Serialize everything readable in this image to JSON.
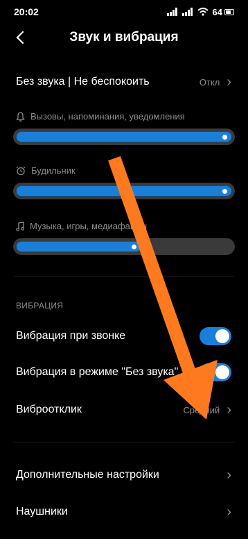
{
  "status": {
    "time": "20:02",
    "battery": "64"
  },
  "header": {
    "title": "Звук и вибрация"
  },
  "dnd": {
    "label": "Без звука | Не беспокоить",
    "value": "Откл"
  },
  "sliders": [
    {
      "label": "Вызовы, напоминания, уведомления",
      "icon": "bell-icon",
      "level_percent": 100
    },
    {
      "label": "Будильник",
      "icon": "alarm-clock-icon",
      "level_percent": 100
    },
    {
      "label": "Музыка, игры, медиафайлы",
      "icon": "music-note-icon",
      "level_percent": 58
    }
  ],
  "vibration": {
    "section_title": "ВИБРАЦИЯ",
    "ring_label": "Вибрация при звонке",
    "ring_on": true,
    "silent_label": "Вибрация в режиме \"Без звука\"",
    "silent_on": true,
    "feedback_label": "Виброотклик",
    "feedback_value": "Средний"
  },
  "more": {
    "advanced_label": "Дополнительные настройки",
    "headphones_label": "Наушники"
  },
  "colors": {
    "accent": "#1a7fd9",
    "annotation_arrow": "#ff7a1f"
  }
}
